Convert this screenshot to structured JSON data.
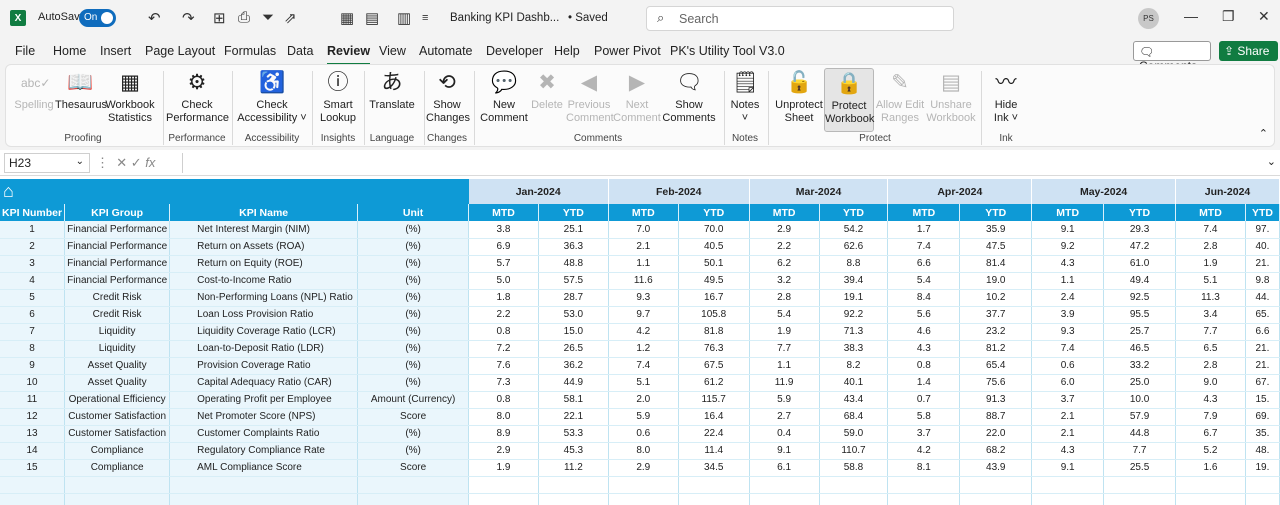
{
  "titlebar": {
    "app_icon": "X",
    "autosave_label": "AutoSave",
    "toggle_label": "On",
    "doc_title": "Banking KPI Dashb...",
    "saved": "• Saved",
    "search_placeholder": "Search",
    "avatar": "PS"
  },
  "menus": [
    "File",
    "Home",
    "Insert",
    "Page Layout",
    "Formulas",
    "Data",
    "Review",
    "View",
    "Automate",
    "Developer",
    "Help",
    "Power Pivot",
    "PK's Utility Tool V3.0"
  ],
  "active_menu": "Review",
  "comments_btn": "Comments",
  "share_btn": "Share",
  "ribbon": {
    "buttons": [
      {
        "l1": "Spelling",
        "l2": "",
        "icon": "abc✓",
        "dis": true
      },
      {
        "l1": "Thesaurus",
        "l2": "",
        "icon": "📖"
      },
      {
        "l1": "Workbook",
        "l2": "Statistics",
        "icon": "▦"
      },
      {
        "l1": "Check",
        "l2": "Performance",
        "icon": "⚙"
      },
      {
        "l1": "Check",
        "l2": "Accessibility ˅",
        "icon": "♿"
      },
      {
        "l1": "Smart",
        "l2": "Lookup",
        "icon": "ⓘ"
      },
      {
        "l1": "Translate",
        "l2": "",
        "icon": "あ"
      },
      {
        "l1": "Show",
        "l2": "Changes",
        "icon": "⟲"
      },
      {
        "l1": "New",
        "l2": "Comment",
        "icon": "💬"
      },
      {
        "l1": "Delete",
        "l2": "",
        "icon": "✖",
        "dis": true
      },
      {
        "l1": "Previous",
        "l2": "Comment",
        "icon": "◀",
        "dis": true
      },
      {
        "l1": "Next",
        "l2": "Comment",
        "icon": "▶",
        "dis": true
      },
      {
        "l1": "Show",
        "l2": "Comments",
        "icon": "🗨"
      },
      {
        "l1": "Notes",
        "l2": "˅",
        "icon": "🗒"
      },
      {
        "l1": "Unprotect",
        "l2": "Sheet",
        "icon": "🔓"
      },
      {
        "l1": "Protect",
        "l2": "Workbook",
        "icon": "🔒",
        "sel": true
      },
      {
        "l1": "Allow Edit",
        "l2": "Ranges",
        "icon": "✎",
        "dis": true
      },
      {
        "l1": "Unshare",
        "l2": "Workbook",
        "icon": "▤",
        "dis": true
      },
      {
        "l1": "Hide",
        "l2": "Ink ˅",
        "icon": "〰"
      }
    ],
    "groups": [
      "Proofing",
      "Performance",
      "Accessibility",
      "Insights",
      "Language",
      "Changes",
      "Comments",
      "Notes",
      "Protect",
      "Ink"
    ]
  },
  "formula": {
    "namebox": "H23",
    "fx": "fx",
    "value": ""
  },
  "sheet": {
    "months": [
      "Jan-2024",
      "Feb-2024",
      "Mar-2024",
      "Apr-2024",
      "May-2024",
      "Jun-2024"
    ],
    "headers": [
      "KPI Number",
      "KPI Group",
      "KPI Name",
      "Unit",
      "MTD",
      "YTD",
      "MTD",
      "YTD",
      "MTD",
      "YTD",
      "MTD",
      "YTD",
      "MTD",
      "YTD",
      "MTD",
      "YTD"
    ],
    "rows": [
      [
        "1",
        "Financial Performance",
        "Net Interest Margin (NIM)",
        "(%)",
        "3.8",
        "25.1",
        "7.0",
        "70.0",
        "2.9",
        "54.2",
        "1.7",
        "35.9",
        "9.1",
        "29.3",
        "7.4",
        "97."
      ],
      [
        "2",
        "Financial Performance",
        "Return on Assets (ROA)",
        "(%)",
        "6.9",
        "36.3",
        "2.1",
        "40.5",
        "2.2",
        "62.6",
        "7.4",
        "47.5",
        "9.2",
        "47.2",
        "2.8",
        "40."
      ],
      [
        "3",
        "Financial Performance",
        "Return on Equity (ROE)",
        "(%)",
        "5.7",
        "48.8",
        "1.1",
        "50.1",
        "6.2",
        "8.8",
        "6.6",
        "81.4",
        "4.3",
        "61.0",
        "1.9",
        "21."
      ],
      [
        "4",
        "Financial Performance",
        "Cost-to-Income Ratio",
        "(%)",
        "5.0",
        "57.5",
        "11.6",
        "49.5",
        "3.2",
        "39.4",
        "5.4",
        "19.0",
        "1.1",
        "49.4",
        "5.1",
        "9.8"
      ],
      [
        "5",
        "Credit Risk",
        "Non-Performing Loans (NPL) Ratio",
        "(%)",
        "1.8",
        "28.7",
        "9.3",
        "16.7",
        "2.8",
        "19.1",
        "8.4",
        "10.2",
        "2.4",
        "92.5",
        "11.3",
        "44."
      ],
      [
        "6",
        "Credit Risk",
        "Loan Loss Provision Ratio",
        "(%)",
        "2.2",
        "53.0",
        "9.7",
        "105.8",
        "5.4",
        "92.2",
        "5.6",
        "37.7",
        "3.9",
        "95.5",
        "3.4",
        "65."
      ],
      [
        "7",
        "Liquidity",
        "Liquidity Coverage Ratio (LCR)",
        "(%)",
        "0.8",
        "15.0",
        "4.2",
        "81.8",
        "1.9",
        "71.3",
        "4.6",
        "23.2",
        "9.3",
        "25.7",
        "7.7",
        "6.6"
      ],
      [
        "8",
        "Liquidity",
        "Loan-to-Deposit Ratio (LDR)",
        "(%)",
        "7.2",
        "26.5",
        "1.2",
        "76.3",
        "7.7",
        "38.3",
        "4.3",
        "81.2",
        "7.4",
        "46.5",
        "6.5",
        "21."
      ],
      [
        "9",
        "Asset Quality",
        "Provision Coverage Ratio",
        "(%)",
        "7.6",
        "36.2",
        "7.4",
        "67.5",
        "1.1",
        "8.2",
        "0.8",
        "65.4",
        "0.6",
        "33.2",
        "2.8",
        "21."
      ],
      [
        "10",
        "Asset Quality",
        "Capital Adequacy Ratio (CAR)",
        "(%)",
        "7.3",
        "44.9",
        "5.1",
        "61.2",
        "11.9",
        "40.1",
        "1.4",
        "75.6",
        "6.0",
        "25.0",
        "9.0",
        "67."
      ],
      [
        "11",
        "Operational Efficiency",
        "Operating Profit per Employee",
        "Amount (Currency)",
        "0.8",
        "58.1",
        "2.0",
        "115.7",
        "5.9",
        "43.4",
        "0.7",
        "91.3",
        "3.7",
        "10.0",
        "4.3",
        "15."
      ],
      [
        "12",
        "Customer Satisfaction",
        "Net Promoter Score (NPS)",
        "Score",
        "8.0",
        "22.1",
        "5.9",
        "16.4",
        "2.7",
        "68.4",
        "5.8",
        "88.7",
        "2.1",
        "57.9",
        "7.9",
        "69."
      ],
      [
        "13",
        "Customer Satisfaction",
        "Customer Complaints Ratio",
        "(%)",
        "8.9",
        "53.3",
        "0.6",
        "22.4",
        "0.4",
        "59.0",
        "3.7",
        "22.0",
        "2.1",
        "44.8",
        "6.7",
        "35."
      ],
      [
        "14",
        "Compliance",
        "Regulatory Compliance Rate",
        "(%)",
        "2.9",
        "45.3",
        "8.0",
        "11.4",
        "9.1",
        "110.7",
        "4.2",
        "68.2",
        "4.3",
        "7.7",
        "5.2",
        "48."
      ],
      [
        "15",
        "Compliance",
        "AML Compliance Score",
        "Score",
        "1.9",
        "11.2",
        "2.9",
        "34.5",
        "6.1",
        "58.8",
        "8.1",
        "43.9",
        "9.1",
        "25.5",
        "1.6",
        "19."
      ]
    ]
  }
}
